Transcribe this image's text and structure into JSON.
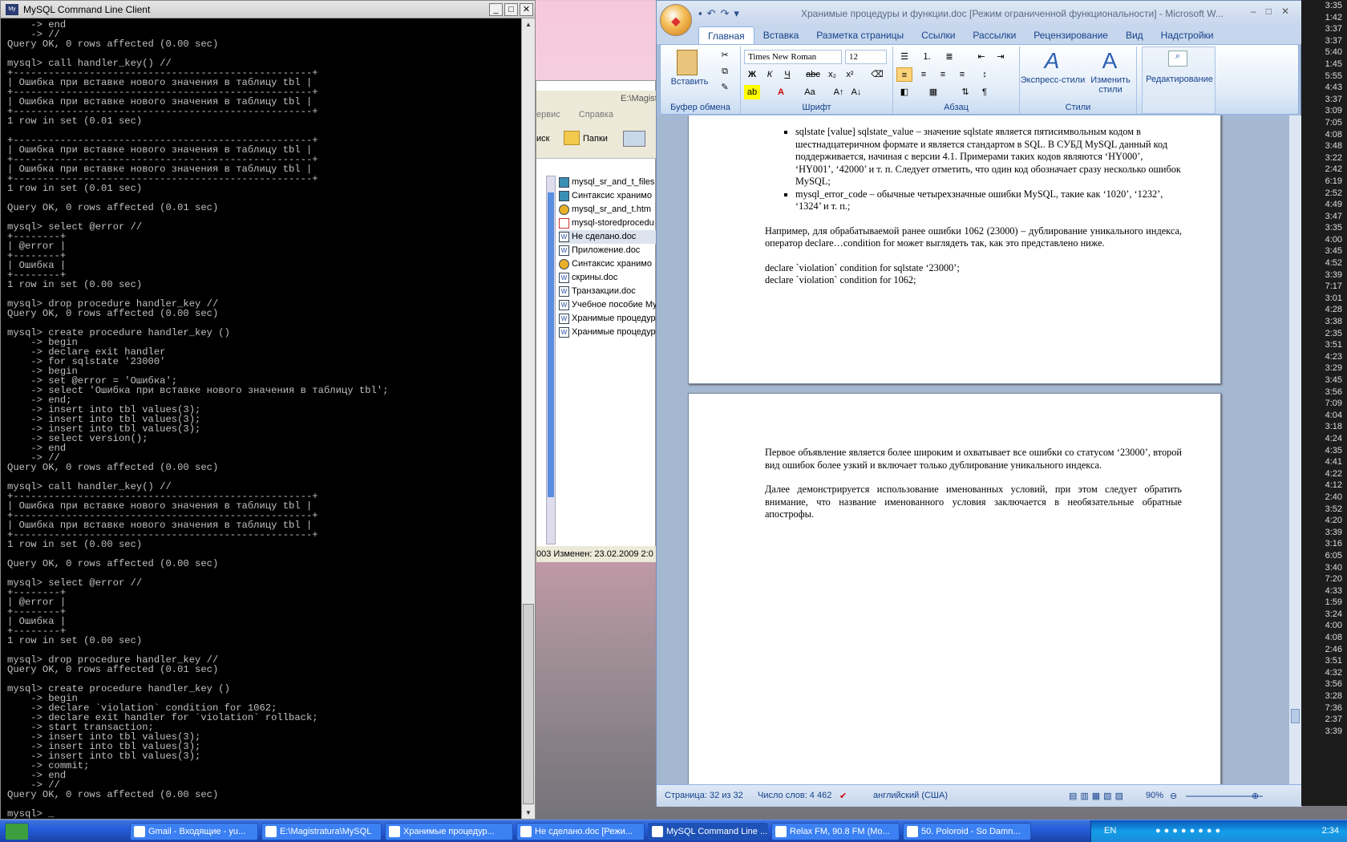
{
  "console": {
    "title": "MySQL Command Line Client",
    "lines": [
      "    -> end",
      "    -> //",
      "Query OK, 0 rows affected (0.00 sec)",
      "",
      "mysql> call handler_key() //",
      "+---------------------------------------------------+",
      "| Ошибка при вставке нового значения в таблицу tbl |",
      "+---------------------------------------------------+",
      "| Ошибка при вставке нового значения в таблицу tbl |",
      "+---------------------------------------------------+",
      "1 row in set (0.01 sec)",
      "",
      "+---------------------------------------------------+",
      "| Ошибка при вставке нового значения в таблицу tbl |",
      "+---------------------------------------------------+",
      "| Ошибка при вставке нового значения в таблицу tbl |",
      "+---------------------------------------------------+",
      "1 row in set (0.01 sec)",
      "",
      "Query OK, 0 rows affected (0.01 sec)",
      "",
      "mysql> select @error //",
      "+--------+",
      "| @error |",
      "+--------+",
      "| Ошибка |",
      "+--------+",
      "1 row in set (0.00 sec)",
      "",
      "mysql> drop procedure handler_key //",
      "Query OK, 0 rows affected (0.00 sec)",
      "",
      "mysql> create procedure handler_key ()",
      "    -> begin",
      "    -> declare exit handler",
      "    -> for sqlstate '23000'",
      "    -> begin",
      "    -> set @error = 'Ошибка';",
      "    -> select 'Ошибка при вставке нового значения в таблицу tbl';",
      "    -> end;",
      "    -> insert into tbl values(3);",
      "    -> insert into tbl values(3);",
      "    -> insert into tbl values(3);",
      "    -> select version();",
      "    -> end",
      "    -> //",
      "Query OK, 0 rows affected (0.00 sec)",
      "",
      "mysql> call handler_key() //",
      "+---------------------------------------------------+",
      "| Ошибка при вставке нового значения в таблицу tbl |",
      "+---------------------------------------------------+",
      "| Ошибка при вставке нового значения в таблицу tbl |",
      "+---------------------------------------------------+",
      "1 row in set (0.00 sec)",
      "",
      "Query OK, 0 rows affected (0.00 sec)",
      "",
      "mysql> select @error //",
      "+--------+",
      "| @error |",
      "+--------+",
      "| Ошибка |",
      "+--------+",
      "1 row in set (0.00 sec)",
      "",
      "mysql> drop procedure handler_key //",
      "Query OK, 0 rows affected (0.01 sec)",
      "",
      "mysql> create procedure handler_key ()",
      "    -> begin",
      "    -> declare `violation` condition for 1062;",
      "    -> declare exit handler for `violation` rollback;",
      "    -> start transaction;",
      "    -> insert into tbl values(3);",
      "    -> insert into tbl values(3);",
      "    -> insert into tbl values(3);",
      "    -> commit;",
      "    -> end",
      "    -> //",
      "Query OK, 0 rows affected (0.00 sec)",
      "",
      "mysql> _"
    ]
  },
  "explorer": {
    "path": "E:\\Magist",
    "menu": [
      "ервис",
      "Справка"
    ],
    "tools": {
      "search": "иск",
      "folders": "Папки"
    },
    "files": [
      "mysql_sr_and_t_files",
      "Синтаксис хранимо",
      "mysql_sr_and_t.htm",
      "mysql-storedprocedu",
      "Не сделано.doc",
      "Приложение.doc",
      "Синтаксис хранимо",
      "скрины.doc",
      "Транзакции.doc",
      "Учебное пособие My",
      "Хранимые процедур",
      "Хранимые процедур"
    ],
    "status": "003 Изменен: 23.02.2009 2:0"
  },
  "word": {
    "title": "Хранимые процедуры и функции.doc [Режим ограниченной функциональности] - Microsoft W...",
    "tabs": [
      "Главная",
      "Вставка",
      "Разметка страницы",
      "Ссылки",
      "Рассылки",
      "Рецензирование",
      "Вид",
      "Надстройки"
    ],
    "ribbon": {
      "paste": "Вставить",
      "clipboard": "Буфер обмена",
      "font_name": "Times New Roman",
      "font_size": "12",
      "font": "Шрифт",
      "paragraph": "Абзац",
      "express_styles": "Экспресс-стили",
      "change_styles_1": "Изменить",
      "change_styles_2": "стили",
      "styles": "Стили",
      "editing": "Редактирование"
    },
    "page1": {
      "bullet1": "sqlstate [value] sqlstate_value – значение sqlstate является пятисимвольным кодом в шестнадцатеричном формате и является стандартом в SQL. В СУБД MySQL данный код поддерживается, начиная с версии 4.1. Примерами таких кодов являются ‘HY000’, ‘HY001’, ‘42000’ и т. п. Следует отметить, что один код обозначает сразу несколько ошибок MySQL;",
      "bullet2": "mysql_error_code – обычные четырехзначные ошибки MySQL, такие как ‘1020’, ‘1232’, ‘1324’ и т. п.;",
      "para": "Например, для обрабатываемой ранее ошибки 1062 (23000) – дублирование уникального индекса, оператор declare…condition for может выглядеть так, как это представлено ниже.",
      "code1": "declare `violation` condition for sqlstate ‘23000’;",
      "code2": "declare `violation` condition for 1062;"
    },
    "page2": {
      "para1": "Первое объявление является более широким и охватывает все ошибки со статусом ‘23000’, второй вид ошибок более узкий и включает только дублирование уникального индекса.",
      "para2": "Далее демонстрируется использование именованных условий, при этом следует обратить внимание, что название именованного условия заключается в необязательные обратные апострофы."
    },
    "status": {
      "page": "Страница: 32 из 32",
      "words": "Число слов: 4 462",
      "lang": "английский (США)",
      "zoom": "90%"
    }
  },
  "clock_times": [
    "3:35",
    "1:42",
    "3:37",
    "3:37",
    "5:40",
    "1:45",
    "5:55",
    "4:43",
    "3:37",
    "3:09",
    "7:05",
    "4:08",
    "3:48",
    "3:22",
    "2:42",
    "6:19",
    "2:52",
    "4:49",
    "3:47",
    "3:35",
    "4:00",
    "3:45",
    "4:52",
    "3:39",
    "7:17",
    "3:01",
    "4:28",
    "3:38",
    "2:35",
    "3:51",
    "4:23",
    "3:29",
    "3:45",
    "3:56",
    "7:09",
    "4:04",
    "3:18",
    "4:24",
    "4:35",
    "4:41",
    "4:22",
    "4:12",
    "2:40",
    "3:52",
    "4:20",
    "3:39",
    "3:16",
    "6:05",
    "3:40",
    "7:20",
    "4:33",
    "1:59",
    "3:24",
    "4:00",
    "4:08",
    "2:46",
    "3:51",
    "4:32",
    "3:56",
    "3:28",
    "7:36",
    "2:37",
    "3:39"
  ],
  "taskbar": {
    "tasks": [
      {
        "label": "Gmail - Входящие - yu..."
      },
      {
        "label": "E:\\Magistratura\\MySQL"
      },
      {
        "label": "Хранимые процедур..."
      },
      {
        "label": "Не сделано.doc [Режи..."
      },
      {
        "label": "MySQL Command Line ..."
      },
      {
        "label": "Relax FM, 90.8 FM (Mo..."
      },
      {
        "label": "50. Poloroid - So Damn..."
      }
    ],
    "lang": "EN",
    "time": "2:34"
  }
}
